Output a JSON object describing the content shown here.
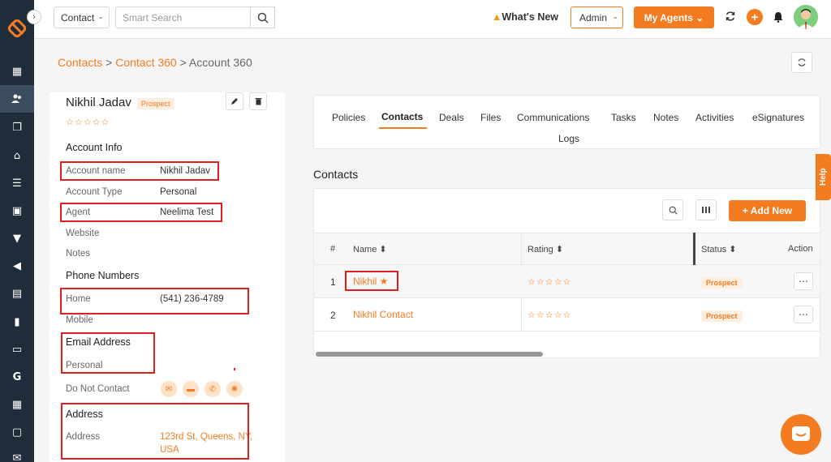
{
  "topbar": {
    "module_select": "Contact",
    "search_placeholder": "Smart Search",
    "whats_new": "What's New",
    "role_select": "Admin",
    "my_agents": "My Agents"
  },
  "breadcrumb": {
    "level1": "Contacts",
    "level2": "Contact 360",
    "current": "Account 360",
    "sep": ">"
  },
  "account": {
    "name": "Nikhil Jadav",
    "tag": "Prospect",
    "stars": "☆☆☆☆☆",
    "sections": {
      "account_info": "Account Info",
      "phone_numbers": "Phone Numbers",
      "email_address": "Email Address",
      "address": "Address"
    },
    "fields": {
      "account_name_label": "Account name",
      "account_name": "Nikhil Jadav",
      "account_type_label": "Account Type",
      "account_type": "Personal",
      "agent_label": "Agent",
      "agent": "Neelima Test",
      "website_label": "Website",
      "notes_label": "Notes",
      "home_label": "Home",
      "home": "(541) 236-4789",
      "mobile_label": "Mobile",
      "personal_label": "Personal",
      "dnc_label": "Do Not Contact",
      "address_label": "Address",
      "address_line1": "123rd St, Queens, NY,",
      "address_line2": "USA"
    }
  },
  "tabs": [
    "Policies",
    "Contacts",
    "Deals",
    "Files",
    "Communications",
    "Tasks",
    "Notes",
    "Activities",
    "eSignatures",
    "Logs"
  ],
  "contacts": {
    "heading": "Contacts",
    "add_new": "+ Add New",
    "columns": {
      "num": "#",
      "name": "Name ⬍",
      "rating": "Rating ⬍",
      "status": "Status ⬍",
      "action": "Action"
    },
    "rows": [
      {
        "num": "1",
        "name": "Nikhil ★",
        "rating": "☆☆☆☆☆",
        "status": "Prospect"
      },
      {
        "num": "2",
        "name": "Nikhil Contact",
        "rating": "☆☆☆☆☆",
        "status": "Prospect"
      }
    ]
  },
  "help": "Help",
  "colors": {
    "accent": "#f47c20",
    "nav": "#1f2d3a",
    "highlight": "#e01e1e"
  }
}
